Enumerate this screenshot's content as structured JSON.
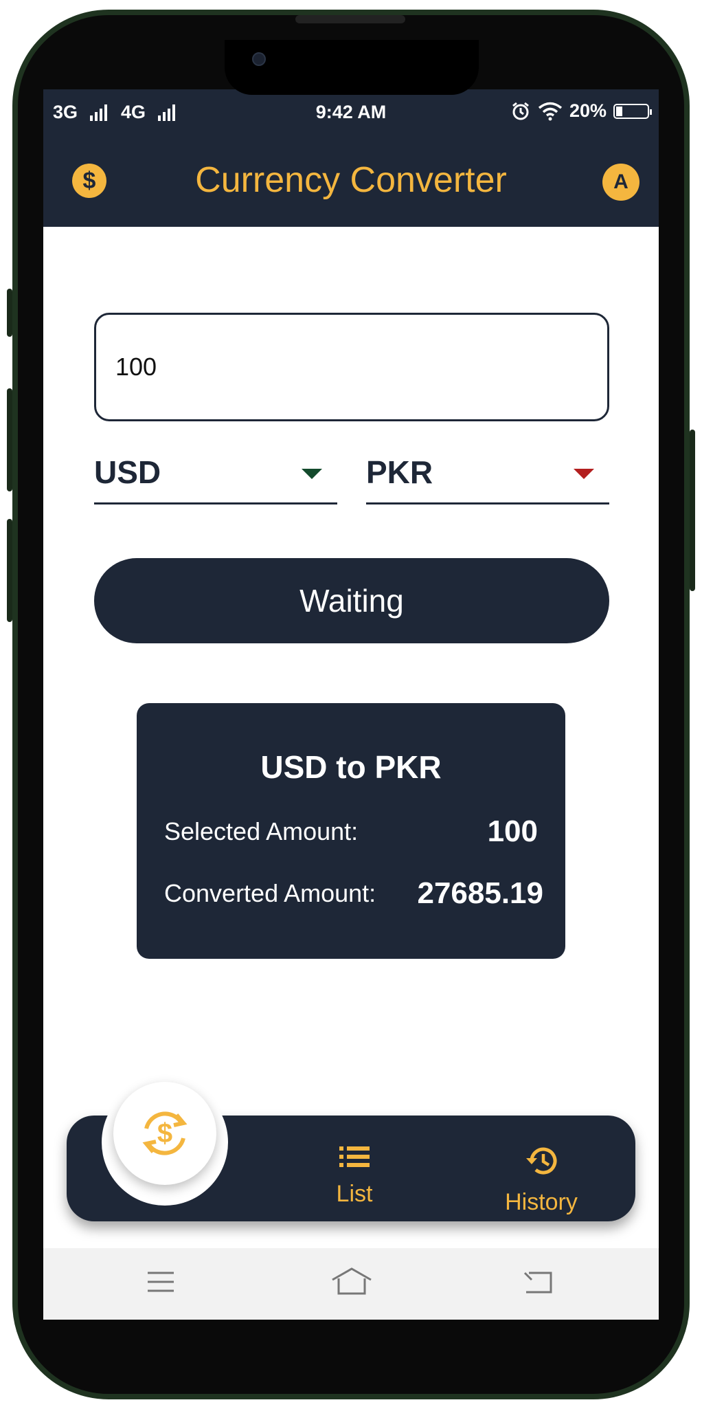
{
  "status_bar": {
    "network_1": "3G",
    "network_2": "4G",
    "time": "9:42 AM",
    "battery": "20%",
    "battery_level": 0.2
  },
  "app_bar": {
    "title": "Currency Converter",
    "left_icon": "dollar-coin-icon",
    "avatar_letter": "A",
    "accent_color": "#f4b63f",
    "bar_color": "#1e2737"
  },
  "converter": {
    "amount_value": "100",
    "from_currency": "USD",
    "to_currency": "PKR",
    "from_caret_color": "#134a2c",
    "to_caret_color": "#b31f1f",
    "button_label": "Waiting"
  },
  "result": {
    "heading": "USD to PKR",
    "selected_label": "Selected Amount:",
    "selected_value": "100",
    "converted_label": "Converted Amount:",
    "converted_value": "27685.19"
  },
  "bottom_nav": {
    "fab_icon": "currency-exchange-icon",
    "items": [
      {
        "label": "List",
        "icon": "list-icon"
      },
      {
        "label": "History",
        "icon": "history-icon"
      }
    ]
  },
  "system_nav": {
    "icons": [
      "menu-icon",
      "home-icon",
      "back-icon"
    ]
  }
}
